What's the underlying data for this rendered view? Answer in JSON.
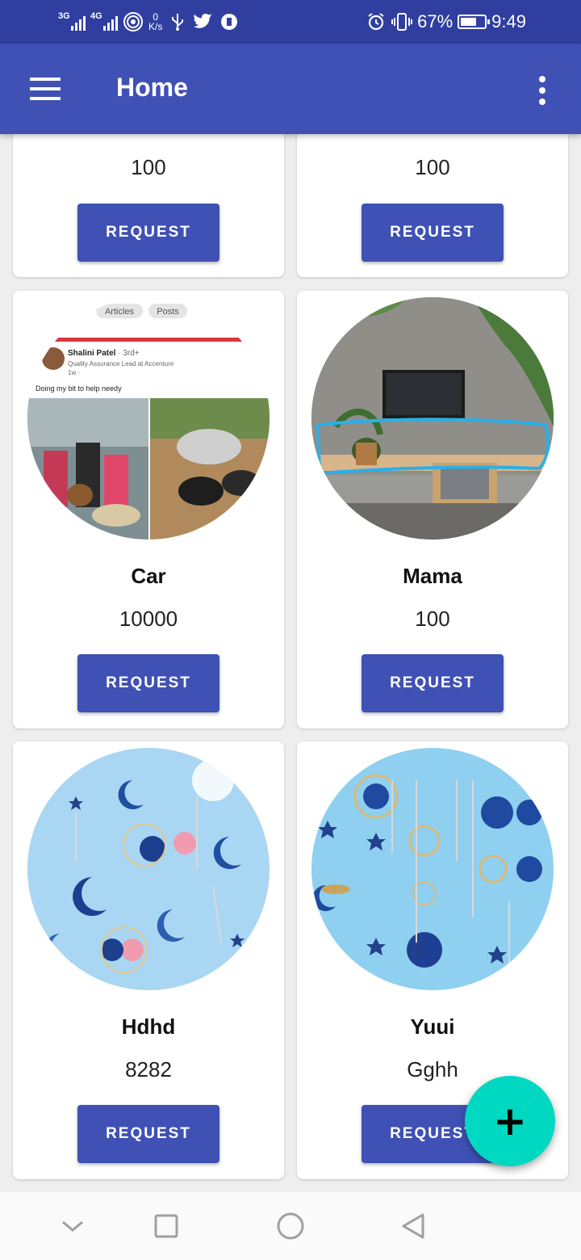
{
  "status_bar": {
    "network_1": "3G",
    "network_2": "4G",
    "speed_value": "0",
    "speed_unit": "K/s",
    "battery": "67%",
    "time": "9:49"
  },
  "app_bar": {
    "title": "Home"
  },
  "colors": {
    "primary": "#3f51b5",
    "primary_dark": "#303f9f",
    "fab": "#00d8c1"
  },
  "cards": [
    {
      "name": "",
      "price": "100",
      "button": "REQUEST"
    },
    {
      "name": "",
      "price": "100",
      "button": "REQUEST"
    },
    {
      "name": "Car",
      "price": "10000",
      "button": "REQUEST",
      "image": {
        "post_tabs": [
          "Articles",
          "Posts"
        ],
        "author": "Shalini Patel",
        "author_meta": "· 3rd+",
        "author_role": "Quality Assurance Lead at Accenture",
        "post_time": "1w · ",
        "post_text": "Doing my bit to help needy"
      }
    },
    {
      "name": "Mama",
      "price": "100",
      "button": "REQUEST"
    },
    {
      "name": "Hdhd",
      "price": "8282",
      "button": "REQUEST"
    },
    {
      "name": "Yuui",
      "price": "Gghh",
      "button": "REQUEST"
    }
  ],
  "fab": {
    "label": "+"
  }
}
